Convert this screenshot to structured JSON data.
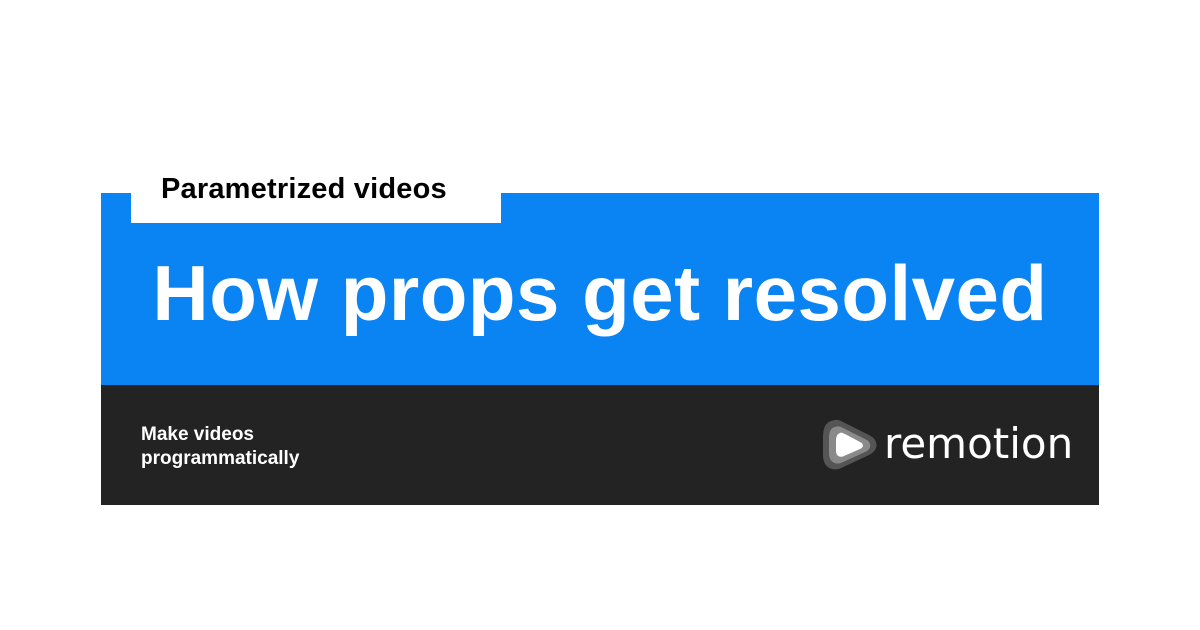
{
  "category": {
    "label": "Parametrized videos"
  },
  "headline": {
    "text": "How props get resolved"
  },
  "footer": {
    "tagline_line1": "Make videos",
    "tagline_line2": "programmatically",
    "brand_name": "remotion",
    "logo_icon": "remotion-play-logo-icon"
  },
  "colors": {
    "accent_blue": "#0b84f3",
    "footer_dark": "#232323",
    "text_light": "#ffffff",
    "text_dark": "#000000"
  }
}
